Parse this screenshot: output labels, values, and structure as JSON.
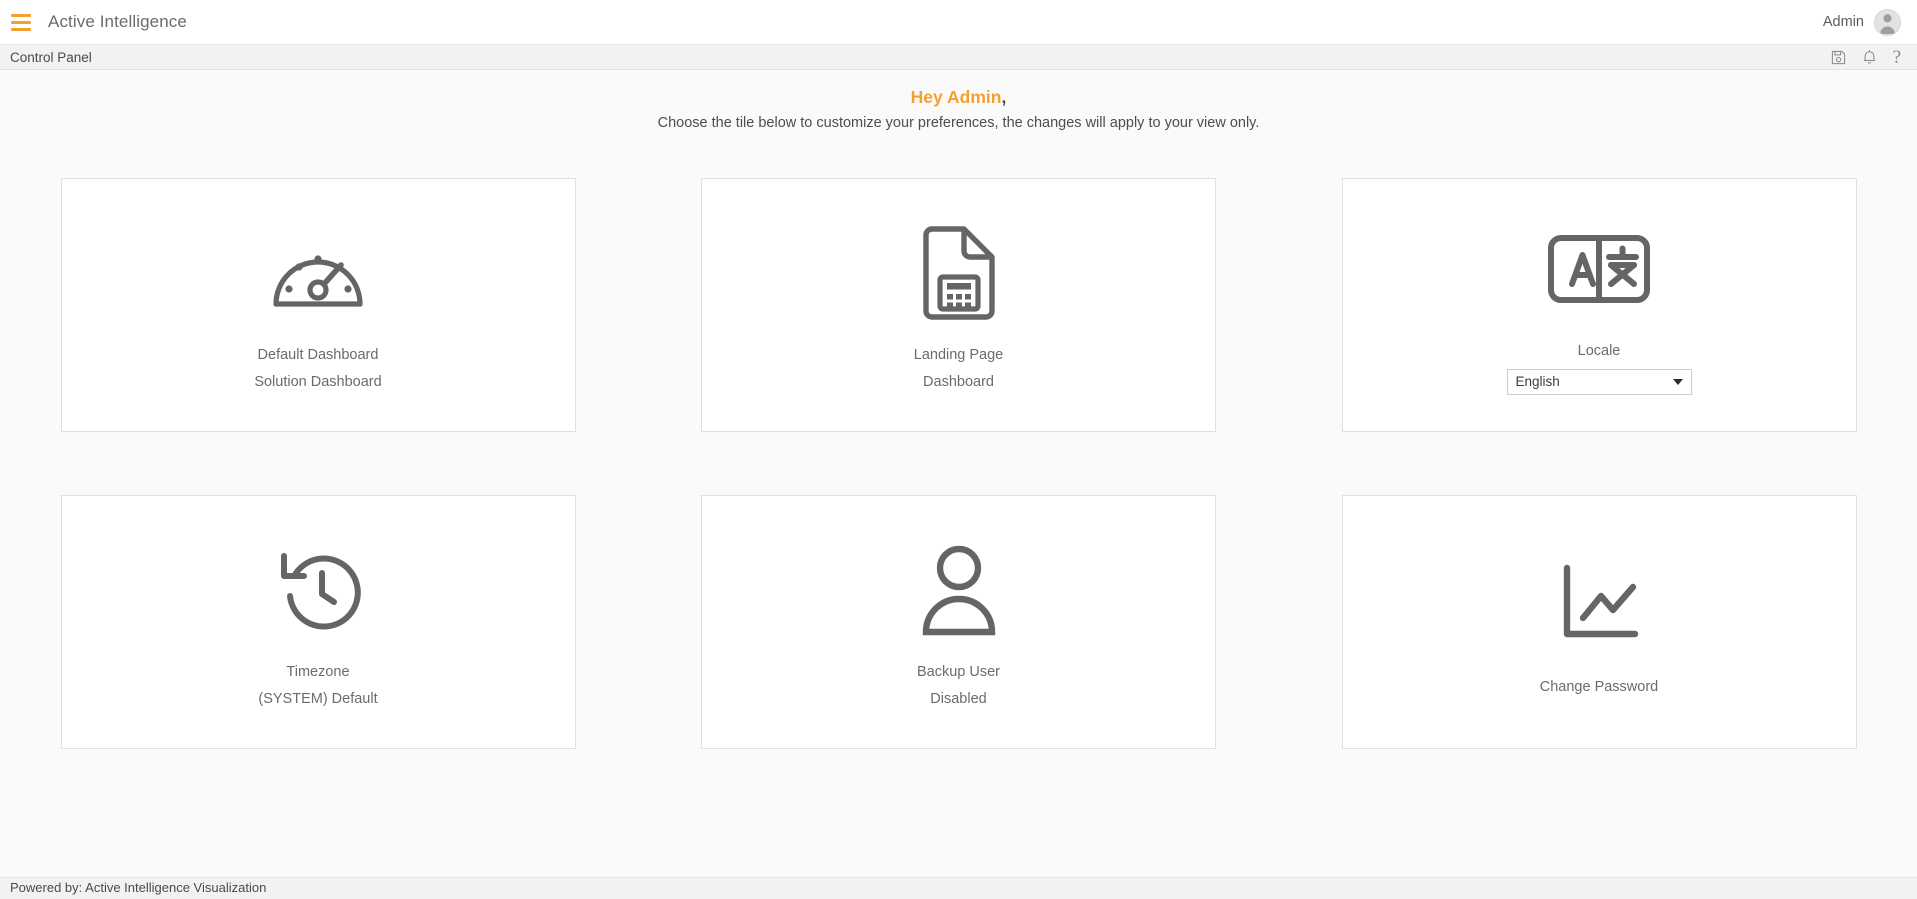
{
  "header": {
    "menu_icon": "hamburger-menu-icon",
    "app_title": "Active Intelligence",
    "user_name": "Admin",
    "avatar_icon": "user-avatar-icon"
  },
  "breadcrumb": {
    "label": "Control Panel",
    "icons": [
      {
        "name": "save-icon",
        "glyph": "floppy-disk"
      },
      {
        "name": "notifications-bell-icon",
        "glyph": "bell"
      },
      {
        "name": "help-icon",
        "glyph": "?"
      }
    ]
  },
  "greeting": {
    "salutation": "Hey Admin",
    "comma": ",",
    "subtitle": "Choose the tile below to customize your preferences, the changes will apply to your view only."
  },
  "tiles": [
    {
      "id": "default-dashboard",
      "icon": "gauge-icon",
      "label": "Default Dashboard",
      "value": "Solution Dashboard"
    },
    {
      "id": "landing-page",
      "icon": "document-report-icon",
      "label": "Landing Page",
      "value": "Dashboard"
    },
    {
      "id": "locale",
      "icon": "translate-icon",
      "label": "Locale",
      "value": "English",
      "control": "dropdown"
    },
    {
      "id": "timezone",
      "icon": "history-clock-icon",
      "label": "Timezone",
      "value": "(SYSTEM) Default"
    },
    {
      "id": "backup-user",
      "icon": "person-icon",
      "label": "Backup User",
      "value": "Disabled"
    },
    {
      "id": "change-password",
      "icon": "line-chart-icon",
      "label": "Change Password",
      "value": ""
    }
  ],
  "footer": {
    "text": "Powered by: Active Intelligence Visualization"
  },
  "colors": {
    "accent": "#f5a02d",
    "icon_gray": "#656565",
    "text_gray": "#6b6b6b",
    "page_bg": "#fafafa",
    "tile_bg": "#ffffff",
    "tile_border": "#e0e0e0",
    "strip_bg": "#f2f2f2"
  }
}
